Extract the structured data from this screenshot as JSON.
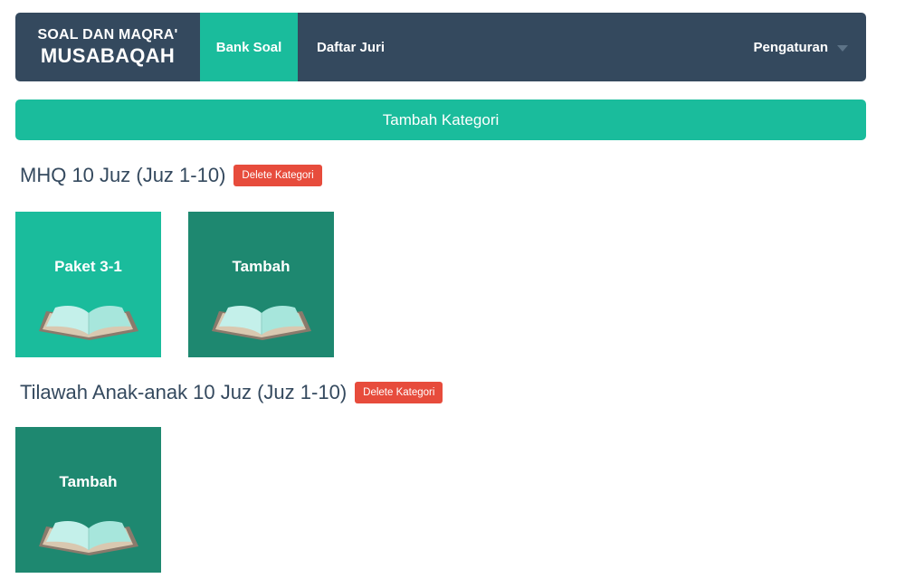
{
  "navbar": {
    "brand_line1": "SOAL DAN MAQRA'",
    "brand_line2": "MUSABAQAH",
    "items": [
      {
        "label": "Bank Soal",
        "active": true
      },
      {
        "label": "Daftar Juri",
        "active": false
      }
    ],
    "settings_label": "Pengaturan"
  },
  "add_category_label": "Tambah Kategori",
  "categories": [
    {
      "title": "MHQ 10 Juz (Juz 1-10)",
      "delete_label": "Delete Kategori",
      "tiles": [
        {
          "label": "Paket 3-1",
          "icon": "open-book-icon",
          "type": "package"
        },
        {
          "label": "Tambah",
          "icon": "open-book-icon",
          "type": "add"
        }
      ]
    },
    {
      "title": "Tilawah Anak-anak 10 Juz (Juz 1-10)",
      "delete_label": "Delete Kategori",
      "tiles": [
        {
          "label": "Tambah",
          "icon": "open-book-icon",
          "type": "add"
        }
      ]
    }
  ],
  "colors": {
    "navbar": "#34495e",
    "accent": "#1abc9c",
    "accent_dark": "#1e8870",
    "danger": "#e74c3c"
  }
}
